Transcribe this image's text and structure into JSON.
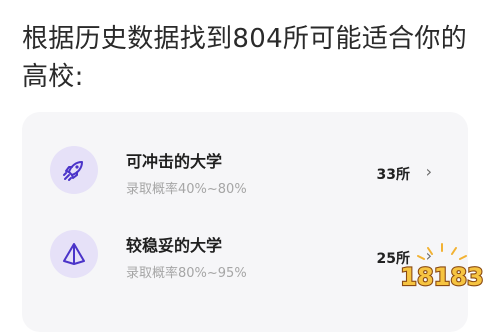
{
  "headline": "根据历史数据找到804所可能适合你的高校:",
  "rows": [
    {
      "icon": "rocket-icon",
      "title": "可冲击的大学",
      "subtitle": "录取概率40%~80%",
      "count": "33所",
      "chevron": "›"
    },
    {
      "icon": "pyramid-icon",
      "title": "较稳妥的大学",
      "subtitle": "录取概率80%~95%",
      "count": "25所",
      "chevron": "›"
    }
  ],
  "watermark": {
    "text": "18183"
  },
  "colors": {
    "accent": "#4b34c9",
    "icon_bg": "#e6e1f8",
    "card_bg": "#f6f6f8",
    "subtitle": "#a6a6a6"
  }
}
